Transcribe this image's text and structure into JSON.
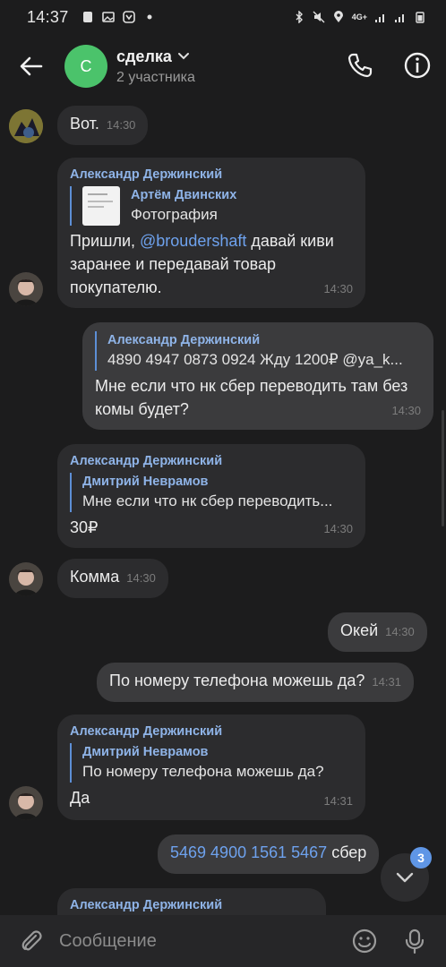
{
  "status": {
    "time": "14:37",
    "network": "4G+"
  },
  "header": {
    "title": "сделка",
    "subtitle": "2 участника",
    "avatar_letter": "С"
  },
  "messages": [
    {
      "text": "Вот.",
      "time": "14:30"
    },
    {
      "author": "Александр Держинский",
      "reply_name": "Артём Двинских",
      "reply_text": "Фотография",
      "text_prefix": "Пришли, ",
      "mention": "@broudershaft",
      "text_suffix": "  давай киви заранее и передавай товар покупателю.",
      "time": "14:30"
    },
    {
      "reply_name": "Александр Держинский",
      "reply_text": "4890 4947 0873 0924 Жду 1200₽ @ya_k...",
      "text": "Мне если что нк сбер переводить там без комы будет?",
      "time": "14:30"
    },
    {
      "author": "Александр Держинский",
      "reply_name": "Дмитрий Неврамов",
      "reply_text": "Мне если что нк сбер переводить...",
      "text": "30₽",
      "time": "14:30"
    },
    {
      "text": "Комма",
      "time": "14:30"
    },
    {
      "text": "Окей",
      "time": "14:30"
    },
    {
      "text": "По номеру телефона можешь да?",
      "time": "14:31"
    },
    {
      "author": "Александр Держинский",
      "reply_name": "Дмитрий Неврамов",
      "reply_text": "По номеру телефона можешь да?",
      "text": "Да",
      "time": "14:31"
    },
    {
      "link": "5469 4900 1561 5467",
      "text": " сбер"
    },
    {
      "author": "Александр Держинский"
    }
  ],
  "unread_badge": "3",
  "input": {
    "placeholder": "Сообщение"
  },
  "colors": {
    "accent": "#6ea2ee",
    "avatar": "#4bc36b",
    "bubble_in": "#2c2c2e",
    "bubble_out": "#3b3b3d"
  }
}
